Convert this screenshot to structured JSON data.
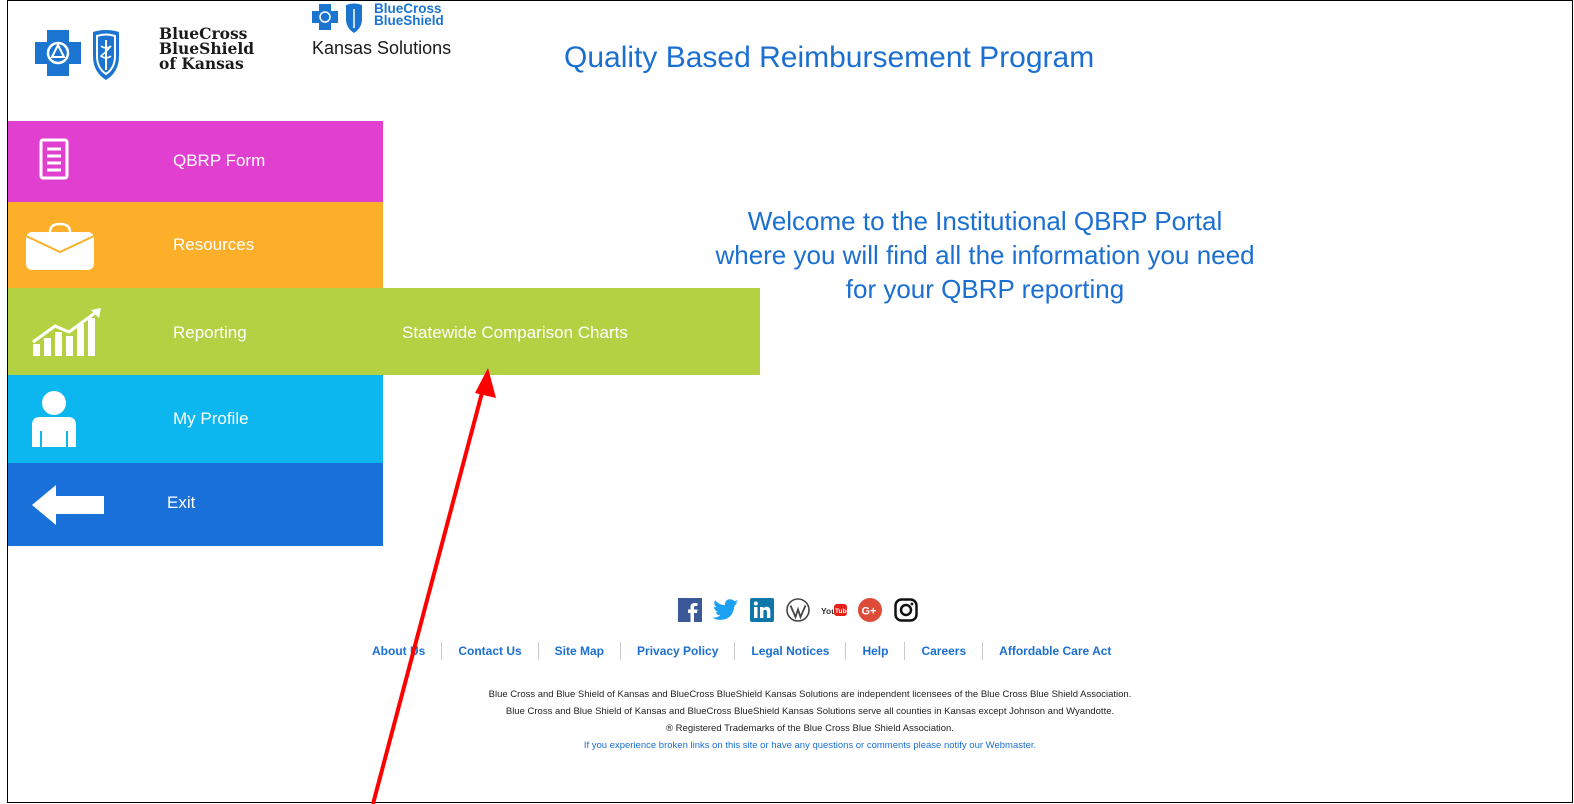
{
  "header": {
    "logo1_lines": [
      "BlueCross",
      "BlueShield",
      "of Kansas"
    ],
    "logo2_lines": [
      "BlueCross",
      "BlueShield"
    ],
    "logo2_sub": "Kansas Solutions",
    "title": "Quality Based Reimbursement Program"
  },
  "nav": {
    "items": [
      {
        "label": "QBRP Form",
        "icon": "document-icon",
        "color": "#e13fd0"
      },
      {
        "label": "Resources",
        "icon": "briefcase-icon",
        "color": "#fdaf29"
      },
      {
        "label": "Reporting",
        "icon": "chart-icon",
        "color": "#b3d143"
      },
      {
        "label": "My Profile",
        "icon": "person-icon",
        "color": "#0cb7ef"
      },
      {
        "label": "Exit",
        "icon": "arrow-left-icon",
        "color": "#1970d8"
      }
    ],
    "submenu": {
      "label": "Statewide Comparison Charts"
    }
  },
  "welcome": {
    "line1": "Welcome to the Institutional QBRP Portal",
    "line2": "where you will find all the information you need",
    "line3": "for your QBRP reporting"
  },
  "social": [
    "facebook-icon",
    "twitter-icon",
    "linkedin-icon",
    "wordpress-icon",
    "youtube-icon",
    "google-plus-icon",
    "instagram-icon"
  ],
  "footer": {
    "links": [
      "About Us",
      "Contact Us",
      "Site Map",
      "Privacy Policy",
      "Legal Notices",
      "Help",
      "Careers",
      "Affordable Care Act"
    ],
    "legal1": "Blue Cross and Blue Shield of Kansas and BlueCross BlueShield Kansas Solutions are independent licensees of the Blue Cross Blue Shield Association.",
    "legal2": "Blue Cross and Blue Shield of Kansas and BlueCross BlueShield Kansas Solutions serve all counties in Kansas except Johnson and Wyandotte.",
    "legal3": "® Registered Trademarks of the Blue Cross Blue Shield Association.",
    "notice": "If you experience broken links on this site or have any questions or comments please notify our Webmaster."
  },
  "colors": {
    "accent": "#1b6fd1",
    "annotation": "#ff0000"
  }
}
